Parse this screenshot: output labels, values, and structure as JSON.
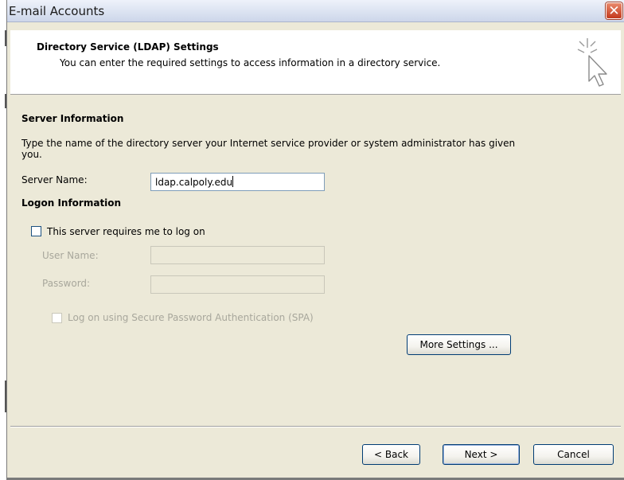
{
  "window": {
    "title": "E-mail Accounts",
    "close_glyph": "✕"
  },
  "header": {
    "title": "Directory Service (LDAP) Settings",
    "subtitle": "You can enter the required settings to access information in a directory service.",
    "icon": "cursor-sparkle-icon"
  },
  "server_info": {
    "heading": "Server Information",
    "description": "Type the name of the directory server your Internet service provider or system administrator has given you.",
    "server_name_label": "Server Name:",
    "server_name_value": "ldap.calpoly.edu"
  },
  "logon_info": {
    "heading": "Logon Information",
    "requires_logon_label": "This server requires me to log on",
    "requires_logon_checked": false,
    "user_name_label": "User Name:",
    "user_name_value": "",
    "password_label": "Password:",
    "password_value": "",
    "spa_label": "Log on using Secure Password Authentication (SPA)",
    "spa_checked": false
  },
  "buttons": {
    "more_settings": "More Settings ...",
    "back": "< Back",
    "next": "Next >",
    "cancel": "Cancel"
  },
  "colors": {
    "dialog_bg": "#ece9d8",
    "title_gradient_top": "#eef2fa",
    "close_red": "#c3391d",
    "button_border": "#003c74",
    "disabled_text": "#a8a79c"
  }
}
